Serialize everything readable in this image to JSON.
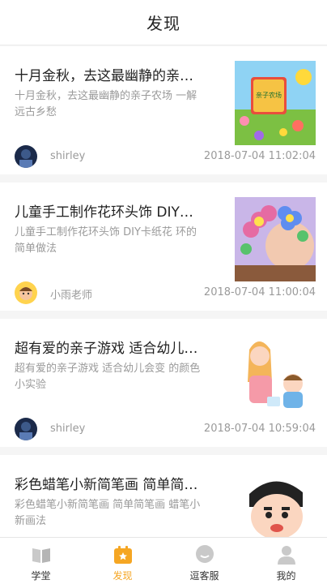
{
  "header": {
    "title": "发现"
  },
  "articles": [
    {
      "title": "十月金秋，去这最幽静的亲…",
      "description": "十月金秋，去这最幽静的亲子农场 一解远古乡愁",
      "author": "shirley",
      "time": "2018-07-04 11:02:04",
      "thumb_text": "亲子农场"
    },
    {
      "title": "儿童手工制作花环头饰 DIY…",
      "description": "儿童手工制作花环头饰 DIY卡纸花 环的简单做法",
      "author": "小雨老师",
      "time": "2018-07-04 11:00:04"
    },
    {
      "title": "超有爱的亲子游戏 适合幼儿…",
      "description": "超有爱的亲子游戏 适合幼儿会变 的颜色小实验",
      "author": "shirley",
      "time": "2018-07-04 10:59:04"
    },
    {
      "title": "彩色蜡笔小新简笔画 简单简…",
      "description": "彩色蜡笔小新简笔画 简单简笔画 蜡笔小新画法",
      "author": "",
      "time": ""
    }
  ],
  "tabbar": {
    "active_color": "#f5a623",
    "items": [
      {
        "label": "学堂",
        "icon": "book-icon"
      },
      {
        "label": "发现",
        "icon": "discover-icon"
      },
      {
        "label": "逗客服",
        "icon": "chat-icon"
      },
      {
        "label": "我的",
        "icon": "profile-icon"
      }
    ]
  }
}
